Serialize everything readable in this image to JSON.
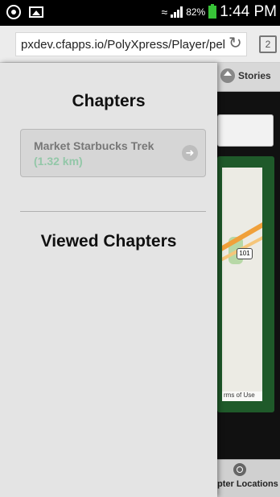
{
  "status_bar": {
    "battery_percent": "82%",
    "time": "1:44 PM"
  },
  "browser": {
    "url": "pxdev.cfapps.io/PolyXpress/Player/pel",
    "tab_count": "2"
  },
  "side_panel": {
    "chapters_title": "Chapters",
    "chapters": [
      {
        "name": "Market Starbucks Trek",
        "distance": "(1.32 km)"
      }
    ],
    "viewed_title": "Viewed Chapters"
  },
  "app": {
    "stories_label": "Stories",
    "map_route_label": "101",
    "map_terms": "rms of Use",
    "footer_label": "pter Locations"
  },
  "colors": {
    "battery": "#38c338",
    "distance": "#93c7a8",
    "map_frame": "#1f5a2a"
  }
}
